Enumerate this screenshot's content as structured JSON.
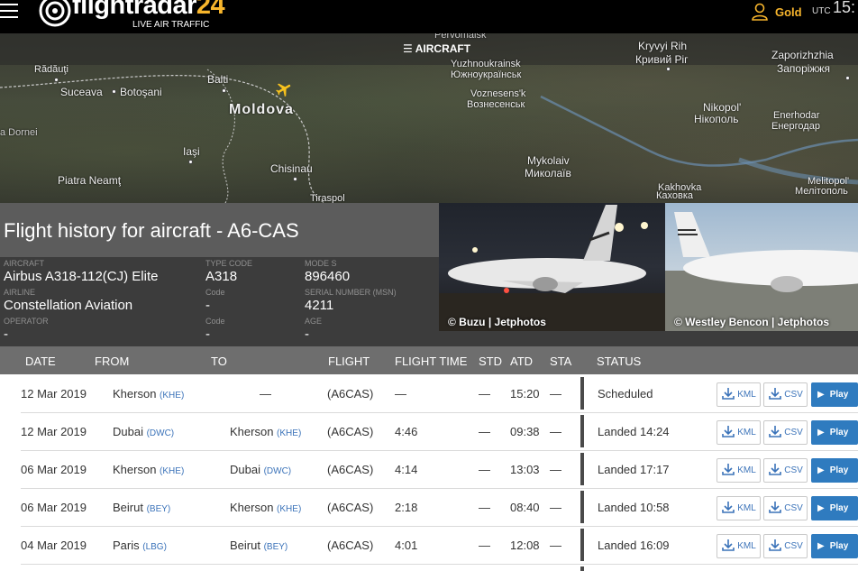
{
  "header": {
    "logo_text": "flightradar",
    "logo_number": "24",
    "logo_tagline": "LIVE AIR TRAFFIC",
    "account_label": "Gold",
    "utc_label": "UTC",
    "clock": "15:"
  },
  "map": {
    "aircraft_button": "AIRCRAFT",
    "labels": {
      "moldova": "Moldova",
      "radauti": "Rădăuţi",
      "suceava": "Suceava",
      "botosani": "Botoşani",
      "balti": "Balti",
      "iasi": "Iaşi",
      "chisinau": "Chisinau",
      "piatra": "Piatra Neamţ",
      "tiraspol": "Tiraspol",
      "dornei": "a Dornei",
      "pervomaisk": "Pervomaisk",
      "yuzhnoukrainsk": "Yuzhnoukrainsk",
      "yuzhnoukrainsk_cyr": "Южноукраїнськ",
      "voznesensk": "Voznesens'k",
      "voznesensk_cyr": "Вознесенськ",
      "mykolaiv": "Mykolaiv",
      "mykolaiv_cyr": "Миколаїв",
      "kryvyi": "Kryvyi Rih",
      "kryvyi_cyr": "Кривий Ріг",
      "nikopol": "Nikopol'",
      "nikopol_cyr": "Нікополь",
      "enerhodar": "Enerhodar",
      "enerhodar_cyr": "Енергодар",
      "zaporizhzhia": "Zaporizhzhia",
      "zaporizhzhia_cyr": "Запоріжжя",
      "kakhovka": "Kakhovka",
      "kakhovka_cyr": "Каховка",
      "melitopol": "Melitopol'",
      "melitopol_cyr": "Мелітополь"
    }
  },
  "aircraft": {
    "title": "Flight history for aircraft - A6-CAS",
    "aircraft_label": "AIRCRAFT",
    "aircraft_value": "Airbus A318-112(CJ) Elite",
    "type_code_label": "TYPE CODE",
    "type_code_value": "A318",
    "mode_s_label": "MODE S",
    "mode_s_value": "896460",
    "airline_label": "AIRLINE",
    "airline_value": "Constellation Aviation",
    "airline_code_label": "Code",
    "airline_code_value": "-",
    "msn_label": "SERIAL NUMBER (MSN)",
    "msn_value": "4211",
    "operator_label": "OPERATOR",
    "operator_value": "-",
    "operator_code_label": "Code",
    "operator_code_value": "-",
    "age_label": "AGE",
    "age_value": "-"
  },
  "photos": [
    {
      "caption": "© Buzu | Jetphotos"
    },
    {
      "caption": "© Westley Bencon | Jetphotos"
    }
  ],
  "table": {
    "headers": {
      "date": "DATE",
      "from": "FROM",
      "to": "TO",
      "flight": "FLIGHT",
      "flight_time": "FLIGHT TIME",
      "std": "STD",
      "atd": "ATD",
      "sta": "STA",
      "status": "STATUS"
    },
    "kml_label": "KML",
    "csv_label": "CSV",
    "play_label": "Play",
    "rows": [
      {
        "date": "12 Mar 2019",
        "from": "Kherson",
        "from_code": "(KHE)",
        "to": "—",
        "to_code": "",
        "flight": "(A6CAS)",
        "flight_time": "—",
        "std": "—",
        "atd": "15:20",
        "sta": "—",
        "status": "Scheduled"
      },
      {
        "date": "12 Mar 2019",
        "from": "Dubai",
        "from_code": "(DWC)",
        "to": "Kherson",
        "to_code": "(KHE)",
        "flight": "(A6CAS)",
        "flight_time": "4:46",
        "std": "—",
        "atd": "09:38",
        "sta": "—",
        "status": "Landed 14:24"
      },
      {
        "date": "06 Mar 2019",
        "from": "Kherson",
        "from_code": "(KHE)",
        "to": "Dubai",
        "to_code": "(DWC)",
        "flight": "(A6CAS)",
        "flight_time": "4:14",
        "std": "—",
        "atd": "13:03",
        "sta": "—",
        "status": "Landed 17:17"
      },
      {
        "date": "06 Mar 2019",
        "from": "Beirut",
        "from_code": "(BEY)",
        "to": "Kherson",
        "to_code": "(KHE)",
        "flight": "(A6CAS)",
        "flight_time": "2:18",
        "std": "—",
        "atd": "08:40",
        "sta": "—",
        "status": "Landed 10:58"
      },
      {
        "date": "04 Mar 2019",
        "from": "Paris",
        "from_code": "(LBG)",
        "to": "Beirut",
        "to_code": "(BEY)",
        "flight": "(A6CAS)",
        "flight_time": "4:01",
        "std": "—",
        "atd": "12:08",
        "sta": "—",
        "status": "Landed 16:09"
      }
    ]
  }
}
